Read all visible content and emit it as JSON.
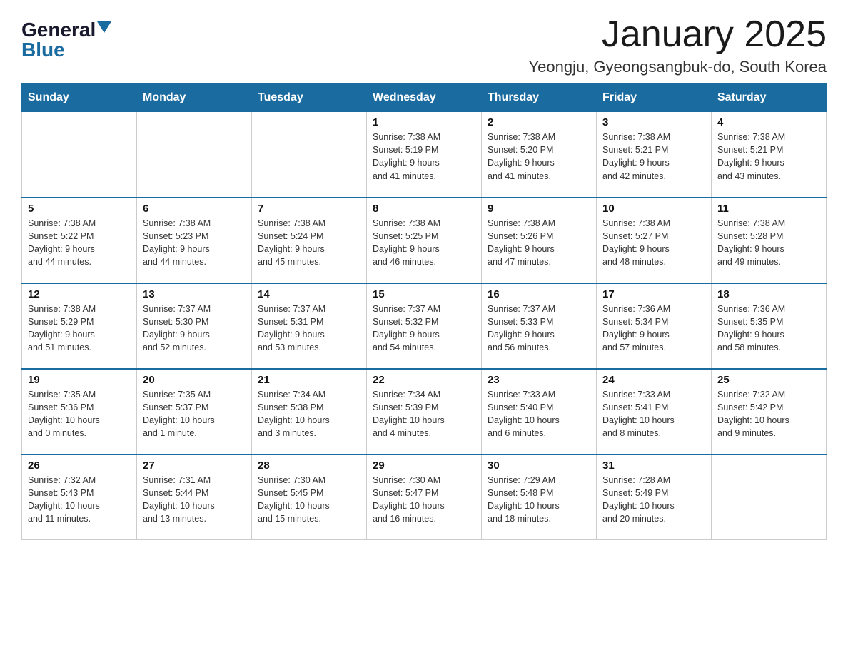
{
  "header": {
    "logo": {
      "general": "General",
      "blue": "Blue"
    },
    "title": "January 2025",
    "subtitle": "Yeongju, Gyeongsangbuk-do, South Korea"
  },
  "weekdays": [
    "Sunday",
    "Monday",
    "Tuesday",
    "Wednesday",
    "Thursday",
    "Friday",
    "Saturday"
  ],
  "weeks": [
    [
      {
        "day": "",
        "info": ""
      },
      {
        "day": "",
        "info": ""
      },
      {
        "day": "",
        "info": ""
      },
      {
        "day": "1",
        "info": "Sunrise: 7:38 AM\nSunset: 5:19 PM\nDaylight: 9 hours\nand 41 minutes."
      },
      {
        "day": "2",
        "info": "Sunrise: 7:38 AM\nSunset: 5:20 PM\nDaylight: 9 hours\nand 41 minutes."
      },
      {
        "day": "3",
        "info": "Sunrise: 7:38 AM\nSunset: 5:21 PM\nDaylight: 9 hours\nand 42 minutes."
      },
      {
        "day": "4",
        "info": "Sunrise: 7:38 AM\nSunset: 5:21 PM\nDaylight: 9 hours\nand 43 minutes."
      }
    ],
    [
      {
        "day": "5",
        "info": "Sunrise: 7:38 AM\nSunset: 5:22 PM\nDaylight: 9 hours\nand 44 minutes."
      },
      {
        "day": "6",
        "info": "Sunrise: 7:38 AM\nSunset: 5:23 PM\nDaylight: 9 hours\nand 44 minutes."
      },
      {
        "day": "7",
        "info": "Sunrise: 7:38 AM\nSunset: 5:24 PM\nDaylight: 9 hours\nand 45 minutes."
      },
      {
        "day": "8",
        "info": "Sunrise: 7:38 AM\nSunset: 5:25 PM\nDaylight: 9 hours\nand 46 minutes."
      },
      {
        "day": "9",
        "info": "Sunrise: 7:38 AM\nSunset: 5:26 PM\nDaylight: 9 hours\nand 47 minutes."
      },
      {
        "day": "10",
        "info": "Sunrise: 7:38 AM\nSunset: 5:27 PM\nDaylight: 9 hours\nand 48 minutes."
      },
      {
        "day": "11",
        "info": "Sunrise: 7:38 AM\nSunset: 5:28 PM\nDaylight: 9 hours\nand 49 minutes."
      }
    ],
    [
      {
        "day": "12",
        "info": "Sunrise: 7:38 AM\nSunset: 5:29 PM\nDaylight: 9 hours\nand 51 minutes."
      },
      {
        "day": "13",
        "info": "Sunrise: 7:37 AM\nSunset: 5:30 PM\nDaylight: 9 hours\nand 52 minutes."
      },
      {
        "day": "14",
        "info": "Sunrise: 7:37 AM\nSunset: 5:31 PM\nDaylight: 9 hours\nand 53 minutes."
      },
      {
        "day": "15",
        "info": "Sunrise: 7:37 AM\nSunset: 5:32 PM\nDaylight: 9 hours\nand 54 minutes."
      },
      {
        "day": "16",
        "info": "Sunrise: 7:37 AM\nSunset: 5:33 PM\nDaylight: 9 hours\nand 56 minutes."
      },
      {
        "day": "17",
        "info": "Sunrise: 7:36 AM\nSunset: 5:34 PM\nDaylight: 9 hours\nand 57 minutes."
      },
      {
        "day": "18",
        "info": "Sunrise: 7:36 AM\nSunset: 5:35 PM\nDaylight: 9 hours\nand 58 minutes."
      }
    ],
    [
      {
        "day": "19",
        "info": "Sunrise: 7:35 AM\nSunset: 5:36 PM\nDaylight: 10 hours\nand 0 minutes."
      },
      {
        "day": "20",
        "info": "Sunrise: 7:35 AM\nSunset: 5:37 PM\nDaylight: 10 hours\nand 1 minute."
      },
      {
        "day": "21",
        "info": "Sunrise: 7:34 AM\nSunset: 5:38 PM\nDaylight: 10 hours\nand 3 minutes."
      },
      {
        "day": "22",
        "info": "Sunrise: 7:34 AM\nSunset: 5:39 PM\nDaylight: 10 hours\nand 4 minutes."
      },
      {
        "day": "23",
        "info": "Sunrise: 7:33 AM\nSunset: 5:40 PM\nDaylight: 10 hours\nand 6 minutes."
      },
      {
        "day": "24",
        "info": "Sunrise: 7:33 AM\nSunset: 5:41 PM\nDaylight: 10 hours\nand 8 minutes."
      },
      {
        "day": "25",
        "info": "Sunrise: 7:32 AM\nSunset: 5:42 PM\nDaylight: 10 hours\nand 9 minutes."
      }
    ],
    [
      {
        "day": "26",
        "info": "Sunrise: 7:32 AM\nSunset: 5:43 PM\nDaylight: 10 hours\nand 11 minutes."
      },
      {
        "day": "27",
        "info": "Sunrise: 7:31 AM\nSunset: 5:44 PM\nDaylight: 10 hours\nand 13 minutes."
      },
      {
        "day": "28",
        "info": "Sunrise: 7:30 AM\nSunset: 5:45 PM\nDaylight: 10 hours\nand 15 minutes."
      },
      {
        "day": "29",
        "info": "Sunrise: 7:30 AM\nSunset: 5:47 PM\nDaylight: 10 hours\nand 16 minutes."
      },
      {
        "day": "30",
        "info": "Sunrise: 7:29 AM\nSunset: 5:48 PM\nDaylight: 10 hours\nand 18 minutes."
      },
      {
        "day": "31",
        "info": "Sunrise: 7:28 AM\nSunset: 5:49 PM\nDaylight: 10 hours\nand 20 minutes."
      },
      {
        "day": "",
        "info": ""
      }
    ]
  ]
}
